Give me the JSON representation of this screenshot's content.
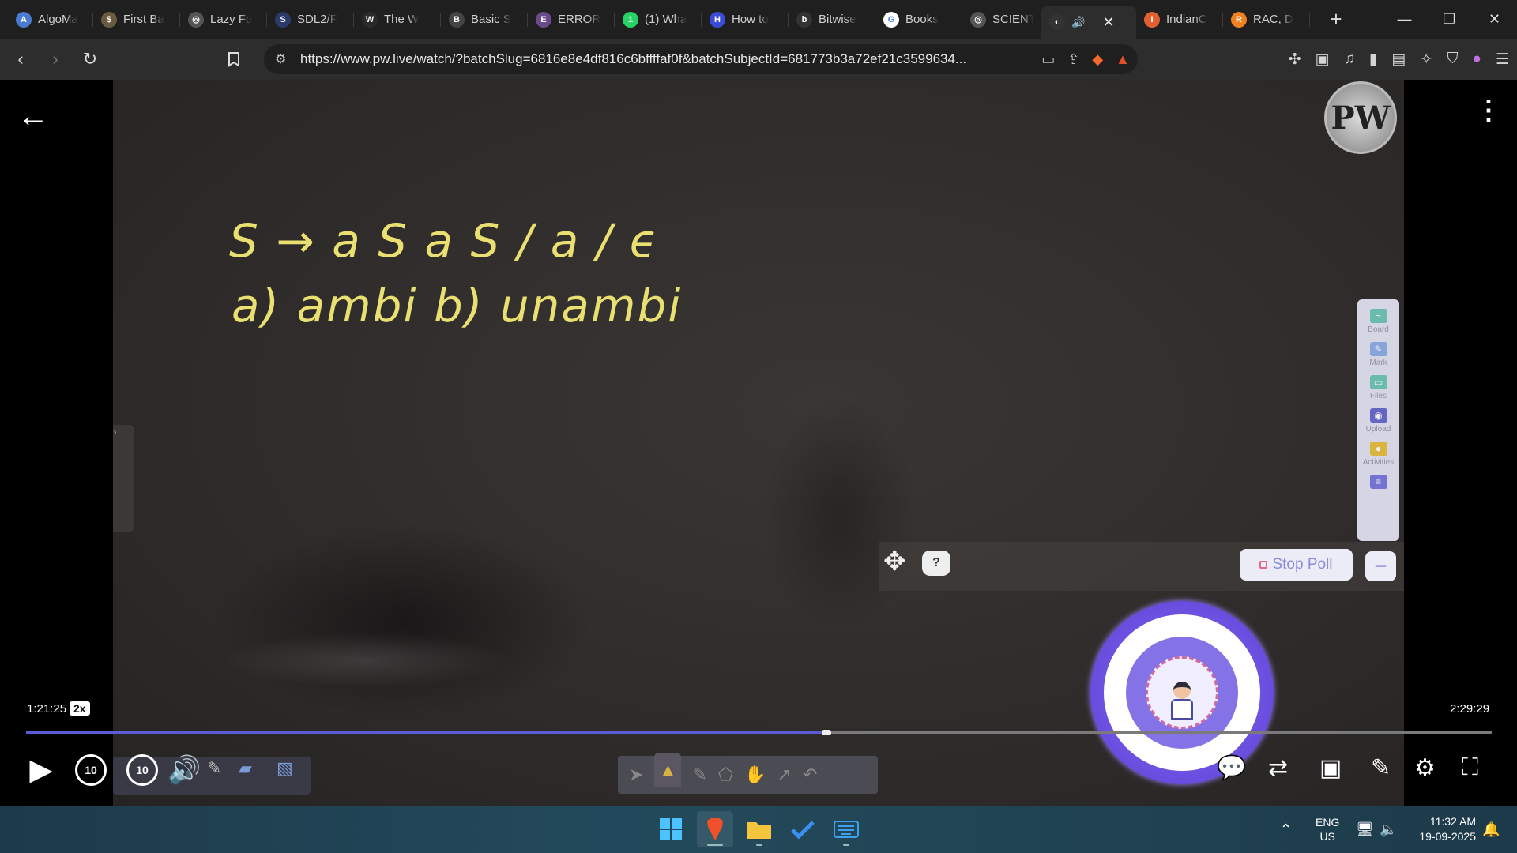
{
  "browser": {
    "tabs": [
      {
        "title": "AlgoMa",
        "fav_color": "#4a7bd0",
        "fav_glyph": "A"
      },
      {
        "title": "First Ba",
        "fav_color": "#6a5a40",
        "fav_glyph": "$"
      },
      {
        "title": "Lazy Fo",
        "fav_color": "#555",
        "fav_glyph": "◎"
      },
      {
        "title": "SDL2/F",
        "fav_color": "#2a3a6a",
        "fav_glyph": "S"
      },
      {
        "title": "The W",
        "fav_color": "#2a2a2a",
        "fav_glyph": "W"
      },
      {
        "title": "Basic S",
        "fav_color": "#444",
        "fav_glyph": "B"
      },
      {
        "title": "ERROR",
        "fav_color": "#6a4a8a",
        "fav_glyph": "E"
      },
      {
        "title": "(1) Wha",
        "fav_color": "#25d366",
        "fav_glyph": "1"
      },
      {
        "title": "How to",
        "fav_color": "#3b4bd8",
        "fav_glyph": "H"
      },
      {
        "title": "Bitwise",
        "fav_color": "#333",
        "fav_glyph": "b"
      },
      {
        "title": "Books",
        "fav_color": "#fff",
        "fav_glyph": "G"
      },
      {
        "title": "SCIENT",
        "fav_color": "#555",
        "fav_glyph": "◎"
      },
      {
        "title": "",
        "fav_color": "#333",
        "fav_glyph": "◐",
        "active": true
      },
      {
        "title": "IndianC",
        "fav_color": "#e06030",
        "fav_glyph": "I"
      },
      {
        "title": "RAC, D",
        "fav_color": "#f08020",
        "fav_glyph": "R"
      }
    ],
    "new_tab": "+",
    "url": "https://www.pw.live/watch/?batchSlug=6816e8e4df816c6bffffaf0f&batchSubjectId=681773b3a72ef21c3599634..."
  },
  "video": {
    "board_text_line1": "S → a S a S / a / ϵ",
    "board_text_line2": "a) ambi    b) unambi",
    "logo_text": "PW",
    "side_panel": [
      {
        "label": "Board",
        "color": "#6fc8b8",
        "glyph": "~"
      },
      {
        "label": "Mark",
        "color": "#8fb0e8",
        "glyph": "✎"
      },
      {
        "label": "Files",
        "color": "#6fc8b8",
        "glyph": "▭"
      },
      {
        "label": "Upload",
        "color": "#6a6ad0",
        "glyph": "◉"
      },
      {
        "label": "Activities",
        "color": "#e8c040",
        "glyph": "●"
      },
      {
        "label": "",
        "color": "#7a7ae0",
        "glyph": "≡"
      }
    ],
    "help_label": "?",
    "stop_poll_label": "Stop Poll",
    "minus_label": "−"
  },
  "player": {
    "current_time": "1:21:25",
    "speed": "2x",
    "total_time": "2:29:29",
    "progress_fraction": 0.546,
    "rewind_label": "10",
    "forward_label": "10"
  },
  "taskbar": {
    "lang_top": "ENG",
    "lang_bottom": "US",
    "time": "11:32 AM",
    "date": "19-09-2025"
  }
}
